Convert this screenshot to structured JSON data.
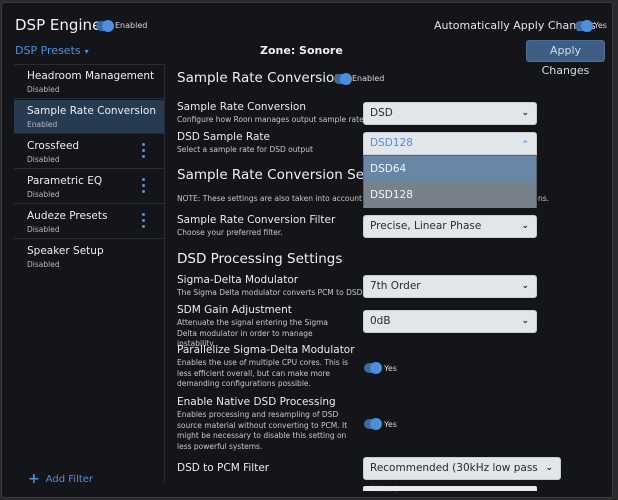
{
  "header": {
    "title": "DSP Engine",
    "engine_toggle_label": "Enabled",
    "engine_enabled": true,
    "auto_apply_label": "Automatically Apply Changes",
    "auto_apply_value": "Yes",
    "auto_apply_enabled": true,
    "presets_label": "DSP Presets",
    "presets_caret": "▾",
    "zone_label": "Zone: Sonore",
    "apply_button": "Apply Changes"
  },
  "sidebar": {
    "items": [
      {
        "name": "Headroom Management",
        "status": "Disabled",
        "active": false,
        "menu": false
      },
      {
        "name": "Sample Rate Conversion",
        "status": "Enabled",
        "active": true,
        "menu": false
      },
      {
        "name": "Crossfeed",
        "status": "Disabled",
        "active": false,
        "menu": true
      },
      {
        "name": "Parametric EQ",
        "status": "Disabled",
        "active": false,
        "menu": true
      },
      {
        "name": "Audeze Presets",
        "status": "Disabled",
        "active": false,
        "menu": true
      },
      {
        "name": "Speaker Setup",
        "status": "Disabled",
        "active": false,
        "menu": false
      }
    ],
    "add_filter": "Add Filter",
    "add_icon": "+"
  },
  "main": {
    "section_title": "Sample Rate Conversion",
    "section_toggle_label": "Enabled",
    "src": {
      "label": "Sample Rate Conversion",
      "desc": "Configure how Roon manages output sample rate.",
      "value": "DSD",
      "chevron": "⌄"
    },
    "dsd_rate": {
      "label": "DSD Sample Rate",
      "desc": "Select a sample rate for DSD output",
      "value": "DSD128",
      "chevron": "⌃",
      "options": [
        "DSD64",
        "DSD128"
      ],
      "highlighted": "DSD64",
      "selected": "DSD128"
    },
    "settings_title": "Sample Rate Conversion Settings",
    "settings_title_visible": "Sample Rate Conversion Settin",
    "note_visible_left": "NOTE: These settings are also taken into account when",
    "note_visible_right": "ns.",
    "filter": {
      "label": "Sample Rate Conversion Filter",
      "desc": "Choose your preferred filter.",
      "value": "Precise, Linear Phase",
      "chevron": "⌄"
    },
    "dsd_title": "DSD Processing Settings",
    "sdm": {
      "label": "Sigma-Delta Modulator",
      "desc": "The Sigma Delta modulator converts PCM to DSD",
      "value": "7th Order",
      "chevron": "⌄"
    },
    "gain": {
      "label": "SDM Gain Adjustment",
      "desc": "Attenuate the signal entering the Sigma Delta modulator in order to manage instability.",
      "value": "0dB",
      "chevron": "⌄"
    },
    "parallel": {
      "label": "Parallelize Sigma-Delta Modulator",
      "desc": "Enables the use of multiple CPU cores. This is less efficient overall, but can make more demanding configurations possible.",
      "value": "Yes",
      "enabled": true
    },
    "native": {
      "label": "Enable Native DSD Processing",
      "desc": "Enables processing and resampling of DSD source material without converting to PCM. It might be necessary to disable this setting on less powerful systems.",
      "value": "Yes",
      "enabled": true
    },
    "pcm_filter": {
      "label": "DSD to PCM Filter",
      "value": "Recommended (30kHz low pass filter)",
      "chevron": "⌄"
    }
  }
}
